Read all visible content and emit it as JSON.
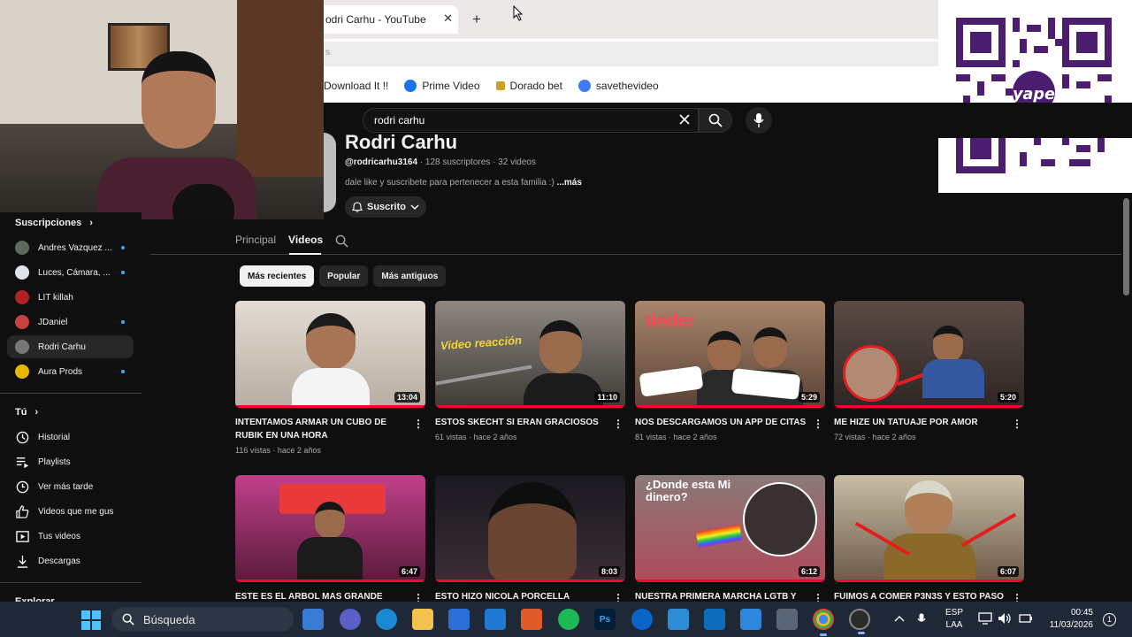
{
  "browser": {
    "tab_title": "odri Carhu - YouTube",
    "tab_close": "✕",
    "new_tab": "+",
    "address_partial": "s",
    "bookmarks": [
      {
        "label": "Download It !!",
        "color": "#ffffff"
      },
      {
        "label": "Prime Video",
        "color": "#1a73e8"
      },
      {
        "label": "Dorado bet",
        "color": "#c9a227"
      },
      {
        "label": "savethevideo",
        "color": "#3b7bff"
      }
    ]
  },
  "youtube": {
    "search_value": "rodri carhu",
    "channel": {
      "name": "Rodri Carhu",
      "handle": "@rodricarhu3164",
      "subscribers": "128 suscriptores",
      "video_count": "32 videos",
      "separator": " · ",
      "description": "dale like y suscribete para pertenecer a esta familia :)",
      "more": "...más",
      "subscribe_label": "Suscrito"
    },
    "tabs": [
      "Principal",
      "Videos"
    ],
    "active_tab": "Videos",
    "chips": [
      "Más recientes",
      "Popular",
      "Más antiguos"
    ],
    "sidebar": {
      "subscriptions_header": "Suscripciones",
      "subscriptions": [
        {
          "label": "Andres Vazquez ...",
          "color": "#5f6b5a",
          "dot": true
        },
        {
          "label": "Luces, Cámara, ...",
          "color": "#dfe4ea",
          "dot": true
        },
        {
          "label": "LIT killah",
          "color": "#b22222",
          "dot": false
        },
        {
          "label": "JDaniel",
          "color": "#c94040",
          "dot": true
        },
        {
          "label": "Rodri Carhu",
          "color": "#777777",
          "dot": false
        },
        {
          "label": "Aura Prods",
          "color": "#e6b800",
          "dot": true
        }
      ],
      "you_header": "Tú",
      "you_items": [
        {
          "label": "Historial",
          "icon": "history-icon"
        },
        {
          "label": "Playlists",
          "icon": "playlist-icon"
        },
        {
          "label": "Ver más tarde",
          "icon": "clock-icon"
        },
        {
          "label": "Videos que me gus...",
          "icon": "thumbs-up-icon"
        },
        {
          "label": "Tus videos",
          "icon": "video-icon"
        },
        {
          "label": "Descargas",
          "icon": "download-icon"
        }
      ],
      "explore_partial": "Explorar"
    },
    "videos": [
      {
        "title": "INTENTAMOS ARMAR UN CUBO DE RUBIK EN UNA HORA",
        "meta": "116 vistas · hace 2 años",
        "duration": "13:04",
        "bg": "#cfc6bd"
      },
      {
        "title": "ESTOS SKECHT SI ERAN GRACIOSOS",
        "meta": "61 vistas · hace 2 años",
        "duration": "11:10",
        "bg": "#6d6660"
      },
      {
        "title": "NOS DESCARGAMOS UN APP DE CITAS",
        "meta": "81 vistas · hace 2 años",
        "duration": "5:29",
        "bg": "#8a6a55"
      },
      {
        "title": "ME HIZE UN TATUAJE POR AMOR",
        "meta": "72 vistas · hace 2 años",
        "duration": "5:20",
        "bg": "#4e3e3a"
      },
      {
        "title": "ESTE ES EL ARBOL MAS GRANDE",
        "meta": "",
        "duration": "6:47",
        "bg": "#8a2a4a"
      },
      {
        "title": "ESTO HIZO NICOLA PORCELLA",
        "meta": "",
        "duration": "8:03",
        "bg": "#2a2430"
      },
      {
        "title": "NUESTRA PRIMERA MARCHA LGTB Y",
        "meta": "",
        "duration": "6:12",
        "bg": "#7a6a6a"
      },
      {
        "title": "FUIMOS A COMER P3N3S Y ESTO PASO",
        "meta": "",
        "duration": "6:07",
        "bg": "#9a8a70"
      }
    ],
    "thumb_overlays": {
      "reaction": "Video reacción",
      "tinder": "tinder",
      "donde": "¿Donde esta Mi dinero?"
    }
  },
  "taskbar": {
    "search_label": "Búsqueda",
    "lang_top": "ESP",
    "lang_bottom": "LAA",
    "time": "00:45",
    "date": "11/03/2026",
    "notification_count": "1"
  }
}
